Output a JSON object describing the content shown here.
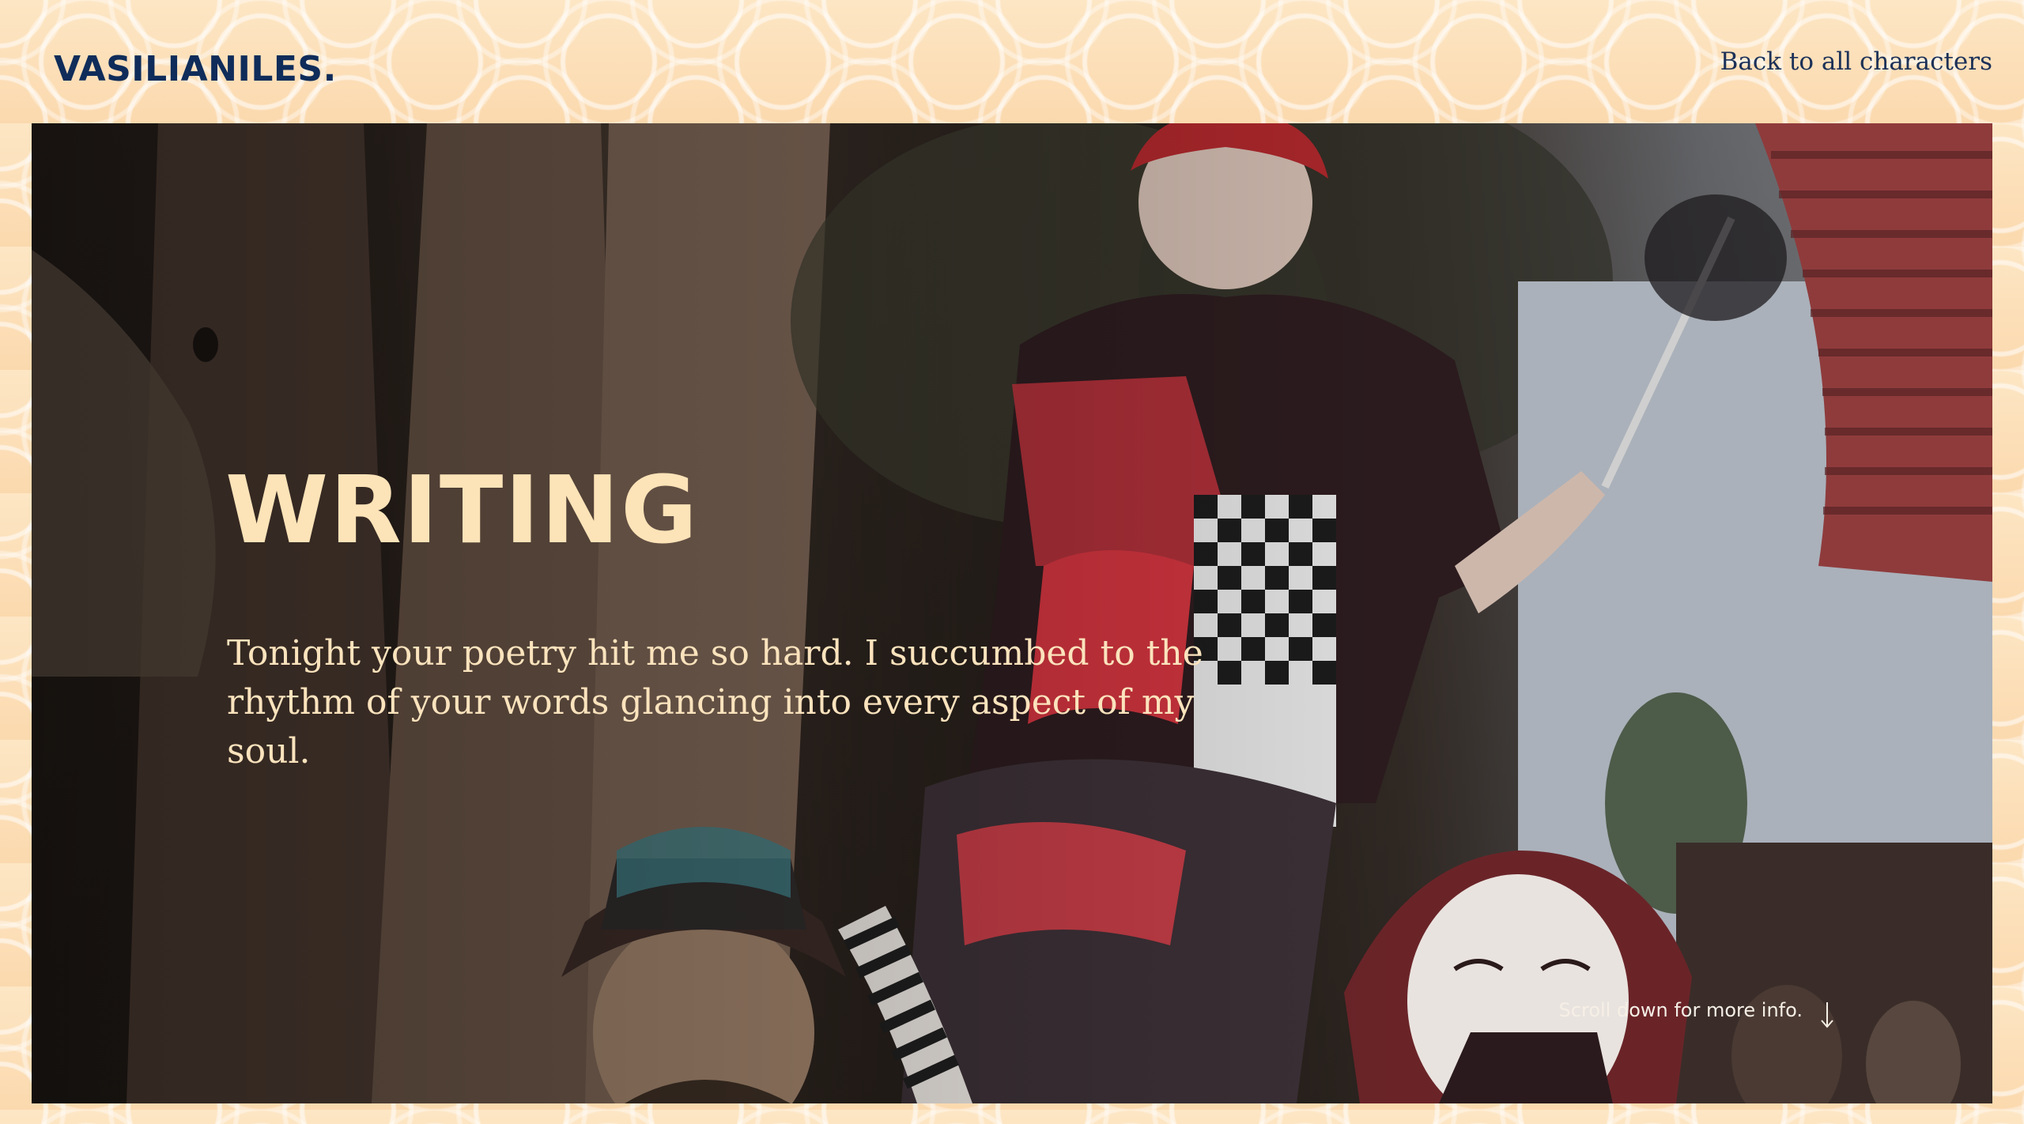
{
  "header": {
    "logo": "VASILIANILES.",
    "back_link": "Back to all characters"
  },
  "hero": {
    "title": "WRITING",
    "text": "Tonight your poetry hit me so hard. I succumbed to the rhythm of your words glancing into every aspect of my soul.",
    "scroll_hint": "Scroll down for more info.",
    "scroll_icon": "arrow-down-icon",
    "image_subject": "costumed-performers-photo"
  },
  "colors": {
    "logo": "#0f2c5a",
    "back_link": "#1c3158",
    "title": "#fde3b8",
    "text": "#fbe3bd",
    "background_pattern": "#fde3bf"
  }
}
